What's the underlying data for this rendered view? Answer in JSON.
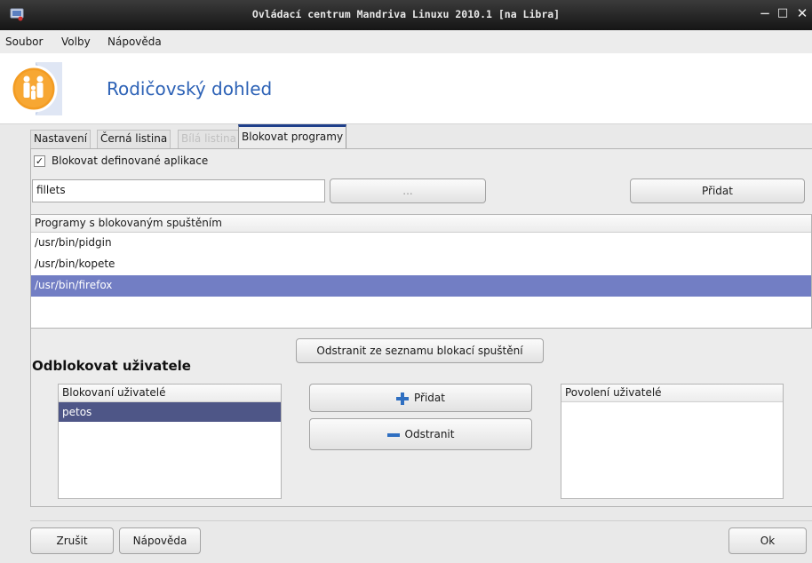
{
  "window": {
    "title": "Ovládací centrum Mandriva Linuxu 2010.1 [na Libra]",
    "minimize_glyph": "−",
    "maximize_glyph": "□",
    "close_glyph": "✕"
  },
  "menu": {
    "items": [
      "Soubor",
      "Volby",
      "Nápověda"
    ]
  },
  "banner": {
    "title": "Rodičovský dohled",
    "icon": "parents-child-icon"
  },
  "tabs": [
    {
      "label": "Nastavení",
      "state": "normal"
    },
    {
      "label": "Černá listina",
      "state": "normal"
    },
    {
      "label": "Bílá listina",
      "state": "disabled"
    },
    {
      "label": "Blokovat programy",
      "state": "active"
    }
  ],
  "block_programs": {
    "checkbox_label": "Blokovat definované aplikace",
    "checkbox_checked": true,
    "checkbox_glyph": "✓",
    "program_input_value": "fillets",
    "browse_label": "...",
    "add_label": "Přidat",
    "list_header": "Programy s blokovaným spuštěním",
    "programs": [
      "/usr/bin/pidgin",
      "/usr/bin/kopete",
      "/usr/bin/firefox"
    ],
    "selected_program": "/usr/bin/firefox",
    "remove_label": "Odstranit ze seznamu blokací spuštění"
  },
  "unblock_users": {
    "title": "Odblokovat uživatele",
    "blocked_header": "Blokovaní uživatelé",
    "blocked_users": [
      "petos"
    ],
    "selected_user": "petos",
    "add_label": "Přidat",
    "remove_label": "Odstranit",
    "allowed_header": "Povolení uživatelé",
    "allowed_users": []
  },
  "footer": {
    "cancel_label": "Zrušit",
    "help_label": "Nápověda",
    "ok_label": "Ok"
  },
  "colors": {
    "accent_title": "#2d62b6",
    "selection": "#727ec4",
    "selection_dark": "#4e5687",
    "active_tab_border": "#1f3f8a",
    "plus_icon": "#2f6fc1",
    "minus_icon": "#2f6fc1"
  }
}
